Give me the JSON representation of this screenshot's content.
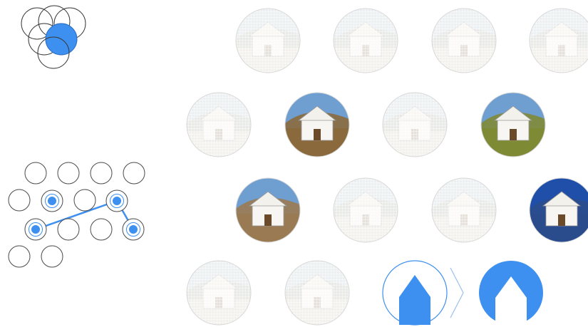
{
  "colors": {
    "accent": "#3d8ff0",
    "outline": "#3a3a3a",
    "light_outline": "#8a8a8a",
    "faded_overlay": "#ffffff"
  },
  "venn_icon": {
    "circles": 5,
    "highlighted": 1
  },
  "pattern_lock": {
    "total_nodes": 14,
    "selected_nodes": 4,
    "connected_path": [
      "node-r2-c2",
      "node-r3-c1",
      "node-r2-c4",
      "node-r3-c5"
    ]
  },
  "thumbnail_grid": {
    "rows": [
      [
        {
          "name": "house-photo-1",
          "state": "faded",
          "tone": "#c9cbc4"
        },
        {
          "name": "house-photo-2",
          "state": "faded",
          "tone": "#d7d2c6"
        },
        {
          "name": "house-photo-3",
          "state": "faded",
          "tone": "#cdd5da"
        },
        {
          "name": "house-photo-4",
          "state": "faded",
          "tone": "#d4cfc2"
        }
      ],
      [
        {
          "name": "house-photo-5",
          "state": "faded",
          "tone": "#cbcbc6"
        },
        {
          "name": "chapel-hillside-photo",
          "state": "active",
          "tone": "#8a6a3c"
        },
        {
          "name": "house-photo-6",
          "state": "faded",
          "tone": "#d3cfc5"
        },
        {
          "name": "vineyard-houses-photo",
          "state": "active",
          "tone": "#7f8a35"
        }
      ],
      [
        {
          "name": "courtyard-photo",
          "state": "active",
          "tone": "#9a7a52"
        },
        {
          "name": "house-photo-7",
          "state": "faded",
          "tone": "#d1d1cc"
        },
        {
          "name": "house-photo-8",
          "state": "faded",
          "tone": "#d8d3c8"
        },
        {
          "name": "white-house-blue-sky-photo",
          "state": "active",
          "tone": "#2a4c8c"
        }
      ],
      [
        {
          "name": "house-photo-9",
          "state": "faded",
          "tone": "#cfd3d4"
        },
        {
          "name": "house-photo-10",
          "state": "faded",
          "tone": "#e2c8b8"
        }
      ]
    ]
  },
  "house_transition": {
    "from": "outline-house-icon",
    "to": "filled-house-icon",
    "separator": "chevron-right-icon"
  }
}
